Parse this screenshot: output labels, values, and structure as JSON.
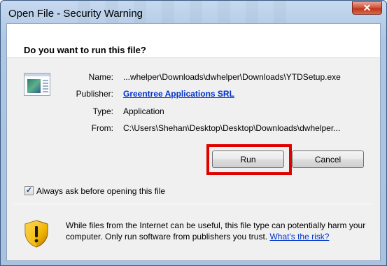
{
  "window": {
    "title": "Open File - Security Warning",
    "close_glyph": "✕"
  },
  "header": {
    "question": "Do you want to run this file?"
  },
  "file_info": {
    "icon": "application-file-icon",
    "name_label": "Name:",
    "name_value": "...whelper\\Downloads\\dwhelper\\Downloads\\YTDSetup.exe",
    "publisher_label": "Publisher:",
    "publisher_value": "Greentree Applications SRL",
    "type_label": "Type:",
    "type_value": "Application",
    "from_label": "From:",
    "from_value": "C:\\Users\\Shehan\\Desktop\\Desktop\\Downloads\\dwhelper..."
  },
  "buttons": {
    "run_label": "Run",
    "cancel_label": "Cancel"
  },
  "checkbox": {
    "checked": true,
    "label": "Always ask before opening this file"
  },
  "warning": {
    "icon": "security-shield-icon",
    "text": "While files from the Internet can be useful, this file type can potentially harm your computer. Only run software from publishers you trust.",
    "link_text": "What's the risk?"
  },
  "colors": {
    "link": "#0033cc",
    "highlight": "#e00000",
    "close_button": "#c1351a"
  }
}
